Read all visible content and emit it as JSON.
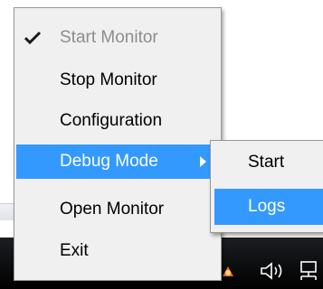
{
  "menu": {
    "items": [
      {
        "label": "Start Monitor",
        "checked": true,
        "disabled": true
      },
      {
        "label": "Stop Monitor"
      },
      {
        "label": "Configuration"
      },
      {
        "label": "Debug Mode",
        "has_submenu": true,
        "highlighted": true
      },
      {
        "label": "Open Monitor"
      },
      {
        "label": "Exit"
      }
    ]
  },
  "submenu": {
    "items": [
      {
        "label": "Start"
      },
      {
        "label": "Logs",
        "highlighted": true
      }
    ]
  },
  "tray": {
    "icons": [
      "app-tray-icon",
      "speaker-icon",
      "network-icon"
    ]
  },
  "colors": {
    "highlight": "#3399ff",
    "menu_bg": "#f0f0f0",
    "disabled_text": "#8d8d8d",
    "taskbar": "#000000"
  }
}
